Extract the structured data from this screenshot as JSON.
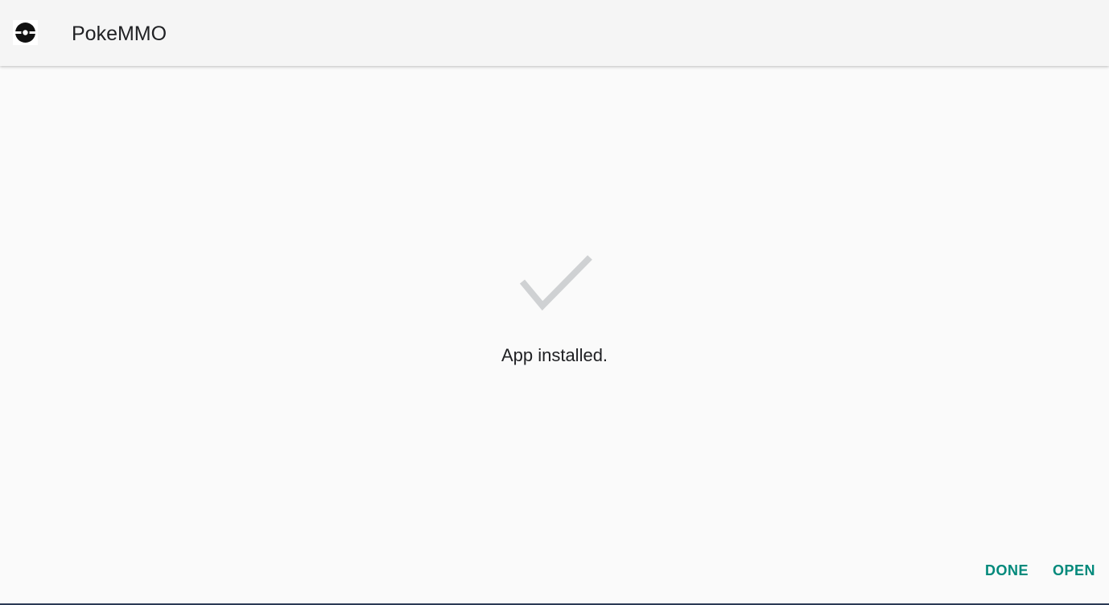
{
  "app_bar": {
    "title": "PokeMMO",
    "icon": "pokeball-icon"
  },
  "main": {
    "status_icon": "checkmark-icon",
    "status_message": "App installed."
  },
  "actions": {
    "done_label": "DONE",
    "open_label": "OPEN"
  },
  "colors": {
    "accent": "#00897b",
    "check": "#cfd1d3",
    "app_bar_bg": "#f5f5f5",
    "page_bg": "#fafafa"
  }
}
